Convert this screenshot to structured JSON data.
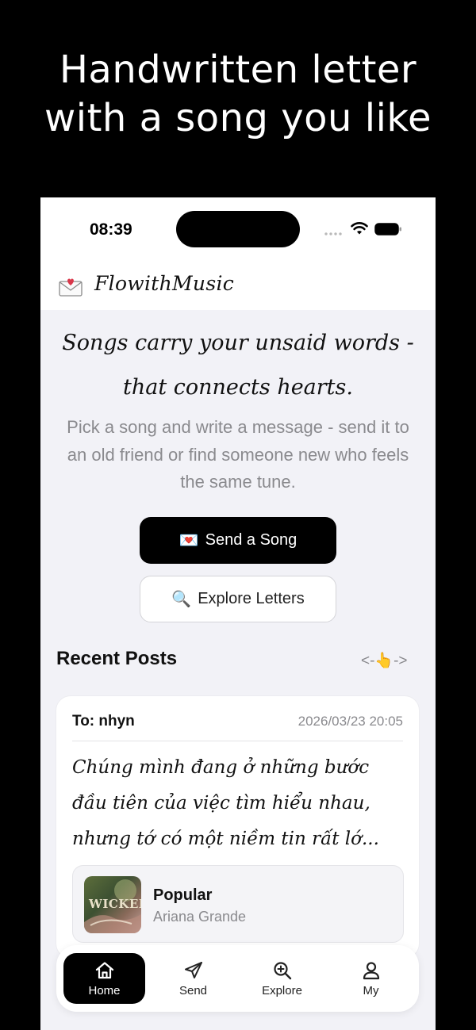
{
  "promo": {
    "line1": "Handwritten letter",
    "line2": "with a song you like"
  },
  "status_bar": {
    "time": "08:39"
  },
  "app": {
    "name": "FlowithMusic",
    "icon": "envelope-heart-icon"
  },
  "hero": {
    "tagline_line1": "Songs carry your unsaid words -",
    "tagline_line2": "that connects hearts.",
    "description": "Pick a song and write a message - send it to an old friend or find someone new who feels the same tune."
  },
  "actions": {
    "send_emoji": "💌",
    "send_label": "Send a Song",
    "explore_emoji": "🔍",
    "explore_label": "Explore Letters"
  },
  "recent": {
    "title": "Recent Posts",
    "scroll_hint": "<-👆->"
  },
  "post": {
    "to": "To: nhyn",
    "date": "2026/03/23 20:05",
    "message": "Chúng mình đang ở những bước đầu tiên của việc tìm hiểu nhau, nhưng tớ có một niềm tin rất lớ...",
    "song": {
      "title": "Popular",
      "artist": "Ariana Grande",
      "cover_text": "WICKED"
    }
  },
  "tabs": [
    {
      "label": "Home",
      "icon": "home-icon",
      "active": true
    },
    {
      "label": "Send",
      "icon": "send-icon",
      "active": false
    },
    {
      "label": "Explore",
      "icon": "explore-icon",
      "active": false
    },
    {
      "label": "My",
      "icon": "profile-icon",
      "active": false
    }
  ]
}
